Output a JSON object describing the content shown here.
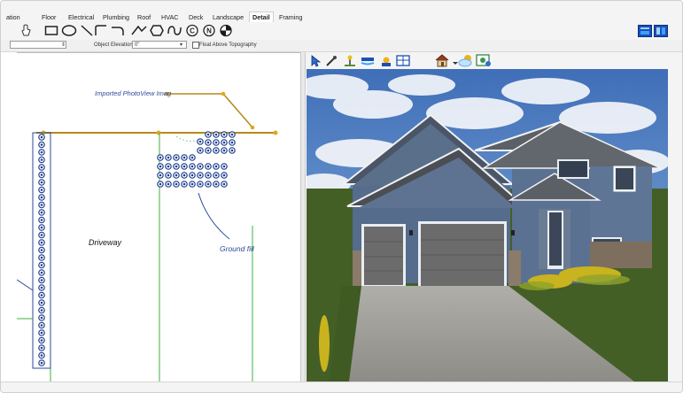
{
  "tabs": [
    {
      "label": "ation"
    },
    {
      "label": "Floor"
    },
    {
      "label": "Electrical"
    },
    {
      "label": "Plumbing"
    },
    {
      "label": "Roof"
    },
    {
      "label": "HVAC"
    },
    {
      "label": "Deck"
    },
    {
      "label": "Landscape"
    },
    {
      "label": "Detail",
      "active": true
    },
    {
      "label": "Framing"
    }
  ],
  "options": {
    "object_elevation_label": "Object Elevation:",
    "object_elevation_value": "0\"",
    "float_label": "Float Above Topography"
  },
  "plan": {
    "photo_label": "Imported PhotoView Imag",
    "driveway_label": "Driveway",
    "ground_fill_label": "Ground fill"
  },
  "colors": {
    "plan_line": "#b38a1a",
    "plant_symbol": "#1f3f8f",
    "guide_green": "#3cb13c",
    "label_blue": "#2c4a9a"
  },
  "icons": {
    "toolbar": [
      "text-icon",
      "rectangle-icon",
      "circle-icon",
      "line-icon",
      "arc-icon",
      "curve-icon",
      "polyline-icon",
      "hexagon-icon",
      "spline-icon",
      "cad-c-icon",
      "north-arrow-icon",
      "dim-icon"
    ],
    "view3d": [
      "select-arrow-icon",
      "eyedropper-icon",
      "sprinkler-icon",
      "paint-icon",
      "sun-icon",
      "layout-icon",
      "house-icon",
      "sky-icon",
      "render-icon"
    ]
  }
}
